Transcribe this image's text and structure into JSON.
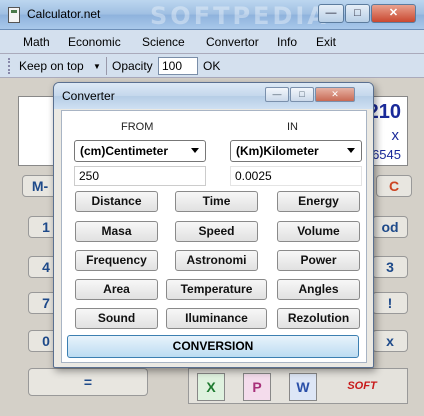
{
  "window": {
    "title": "Calculator.net",
    "watermark": "SOFTPEDIA",
    "min": "—",
    "max": "□",
    "close": "✕"
  },
  "menu": [
    "Math",
    "Economic",
    "Science",
    "Convertor",
    "Info",
    "Exit"
  ],
  "toolbar": {
    "keep_on_top": "Keep on top",
    "opacity_label": "Opacity",
    "opacity_value": "100",
    "ok_label": "OK"
  },
  "calc_display": {
    "line1": "210",
    "line2": "x",
    "line3": "6545"
  },
  "calc_keys": [
    "M-",
    "1",
    "4",
    "7",
    "0",
    "=",
    "od",
    "3",
    "!",
    "x",
    "C"
  ],
  "converter": {
    "title": "Converter",
    "from_label": "FROM",
    "in_label": "IN",
    "from_unit": "(cm)Centimeter",
    "in_unit": "(Km)Kilometer",
    "from_value": "250",
    "result_value": "0.0025",
    "categories": [
      "Distance",
      "Time",
      "Energy",
      "Masa",
      "Speed",
      "Volume",
      "Frequency",
      "Astronomi",
      "Power",
      "Area",
      "Temperature",
      "Angles",
      "Sound",
      "Iluminance",
      "Rezolution"
    ],
    "conversion_label": "CONVERSION"
  },
  "icons": {
    "excel": "X",
    "paint": "P",
    "word": "W",
    "brand": "SOFT"
  },
  "colors": {
    "accent": "#1e4a8a",
    "close": "#c94830",
    "conversion_border": "#3c7fb1"
  }
}
